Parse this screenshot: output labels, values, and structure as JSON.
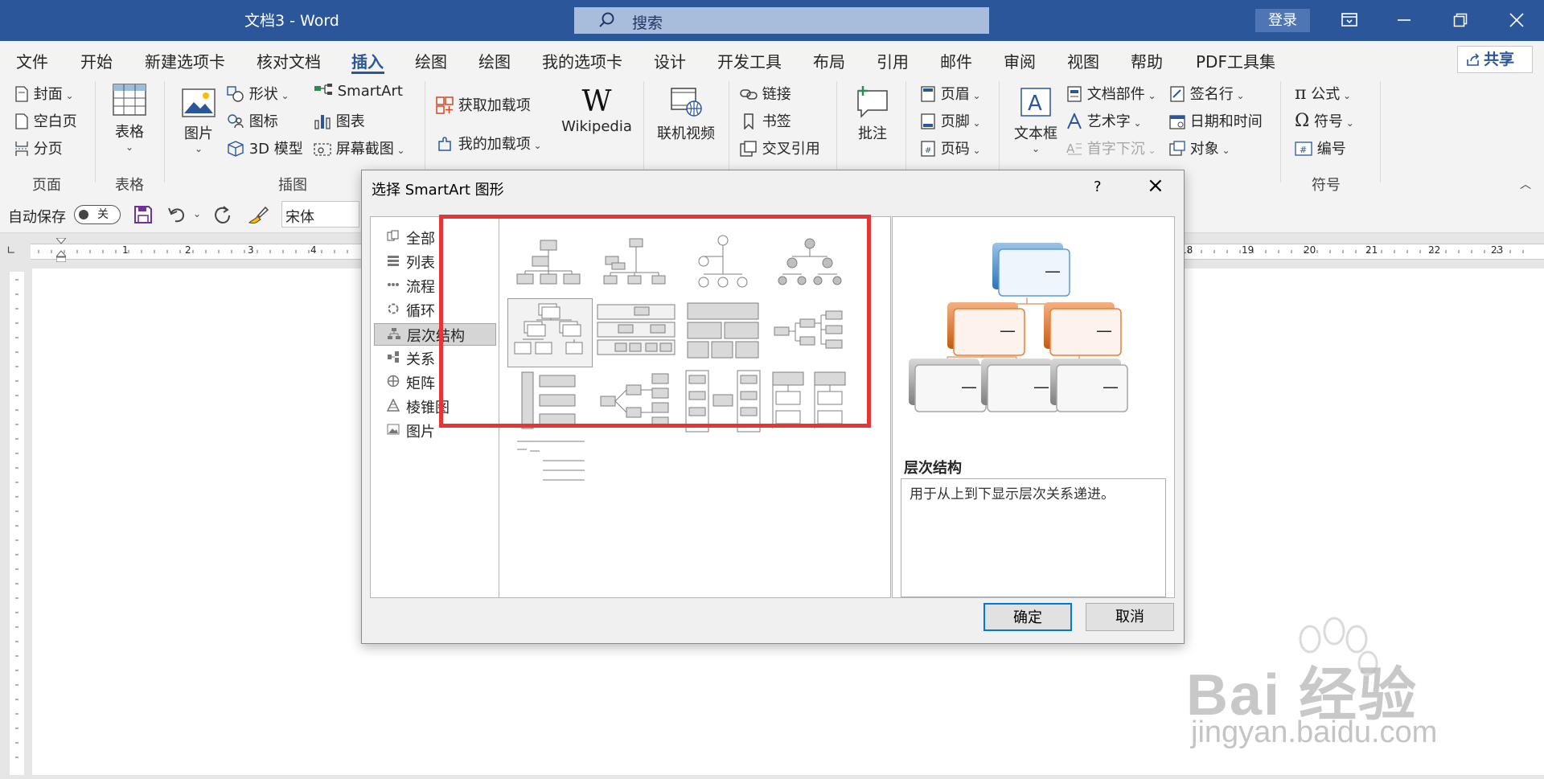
{
  "window": {
    "title": "文档3  -  Word",
    "search_placeholder": "搜索",
    "login_label": "登录"
  },
  "tabs": [
    "文件",
    "开始",
    "新建选项卡",
    "核对文档",
    "插入",
    "绘图",
    "绘图",
    "我的选项卡",
    "设计",
    "开发工具",
    "布局",
    "引用",
    "邮件",
    "审阅",
    "视图",
    "帮助",
    "PDF工具集"
  ],
  "active_tab": "插入",
  "share_label": "共享",
  "ribbon": {
    "pages": {
      "cover": "封面",
      "blank": "空白页",
      "break": "分页",
      "group": "页面"
    },
    "tables": {
      "table": "表格",
      "group": "表格"
    },
    "illustrations": {
      "picture": "图片",
      "shapes": "形状",
      "icons": "图标",
      "models": "3D 模型",
      "smartart": "SmartArt",
      "chart": "图表",
      "screenshot": "屏幕截图",
      "group": "插图"
    },
    "addins": {
      "get": "获取加载项",
      "mine": "我的加载项",
      "wikipedia": "Wikipedia"
    },
    "media": {
      "video": "联机视频"
    },
    "links": {
      "link": "链接",
      "bookmark": "书签",
      "crossref": "交叉引用"
    },
    "comments": {
      "comment": "批注"
    },
    "headerfooter": {
      "header": "页眉",
      "footer": "页脚",
      "pagenum": "页码"
    },
    "text": {
      "textbox": "文本框",
      "parts": "文档部件",
      "wordart": "艺术字",
      "dropcap": "首字下沉",
      "sigline": "签名行",
      "datetime": "日期和时间",
      "object": "对象"
    },
    "symbols": {
      "equation": "公式",
      "symbol": "符号",
      "number": "编号",
      "group": "符号"
    }
  },
  "qat": {
    "autosave": "自动保存",
    "toggle": "关",
    "font": "宋体"
  },
  "ruler_numbers": [
    "1",
    "2",
    "3",
    "4",
    "18",
    "19",
    "20",
    "21",
    "22",
    "23"
  ],
  "dialog": {
    "title": "选择 SmartArt 图形",
    "help": "?",
    "categories": [
      {
        "label": "全部",
        "icon": "all-icon"
      },
      {
        "label": "列表",
        "icon": "list-icon"
      },
      {
        "label": "流程",
        "icon": "process-icon"
      },
      {
        "label": "循环",
        "icon": "cycle-icon"
      },
      {
        "label": "层次结构",
        "icon": "hierarchy-icon"
      },
      {
        "label": "关系",
        "icon": "relationship-icon"
      },
      {
        "label": "矩阵",
        "icon": "matrix-icon"
      },
      {
        "label": "棱锥图",
        "icon": "pyramid-icon"
      },
      {
        "label": "图片",
        "icon": "picture-icon"
      }
    ],
    "selected_category": "层次结构",
    "preview_title": "层次结构",
    "preview_desc": "用于从上到下显示层次关系递进。",
    "preview_dash": "—",
    "ok": "确定",
    "cancel": "取消"
  },
  "watermark": {
    "brand": "Bai  经验",
    "sub": "jingyan.baidu.com"
  },
  "colors": {
    "titlebar": "#2b579a",
    "highlight": "#e53535",
    "accent_orange": "#ed7d31",
    "accent_blue": "#5b9bd5"
  }
}
